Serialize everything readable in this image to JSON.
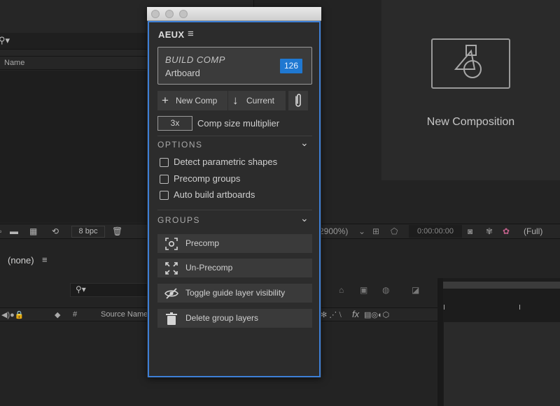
{
  "background": {
    "project_panel": {
      "column_name": "Name"
    },
    "composition_panel": {
      "new_composition_label": "New Composition"
    },
    "toolbar": {
      "bit_depth": "8 bpc",
      "zoom": "2900%)",
      "timecode": "0:00:00:00",
      "resolution": "(Full)"
    },
    "timeline": {
      "comp_name": "(none)",
      "column_num": "#",
      "column_source_name": "Source Name",
      "fx_label": "fx"
    }
  },
  "aeux": {
    "title": "AEUX",
    "build": {
      "title": "BUILD COMP",
      "subtitle": "Artboard",
      "count": "126"
    },
    "buttons": {
      "new_comp": "New Comp",
      "current": "Current"
    },
    "multiplier": {
      "value": "3x",
      "label": "Comp size multiplier"
    },
    "options": {
      "title": "OPTIONS",
      "items": [
        {
          "label": "Detect parametric shapes",
          "checked": false
        },
        {
          "label": "Precomp groups",
          "checked": false
        },
        {
          "label": "Auto build artboards",
          "checked": false
        }
      ]
    },
    "groups": {
      "title": "GROUPS",
      "items": [
        {
          "label": "Precomp",
          "icon": "precomp-icon"
        },
        {
          "label": "Un-Precomp",
          "icon": "expand-icon"
        },
        {
          "label": "Toggle guide layer visibility",
          "icon": "eye-slash-icon"
        },
        {
          "label": "Delete group layers",
          "icon": "trash-icon"
        }
      ]
    }
  }
}
